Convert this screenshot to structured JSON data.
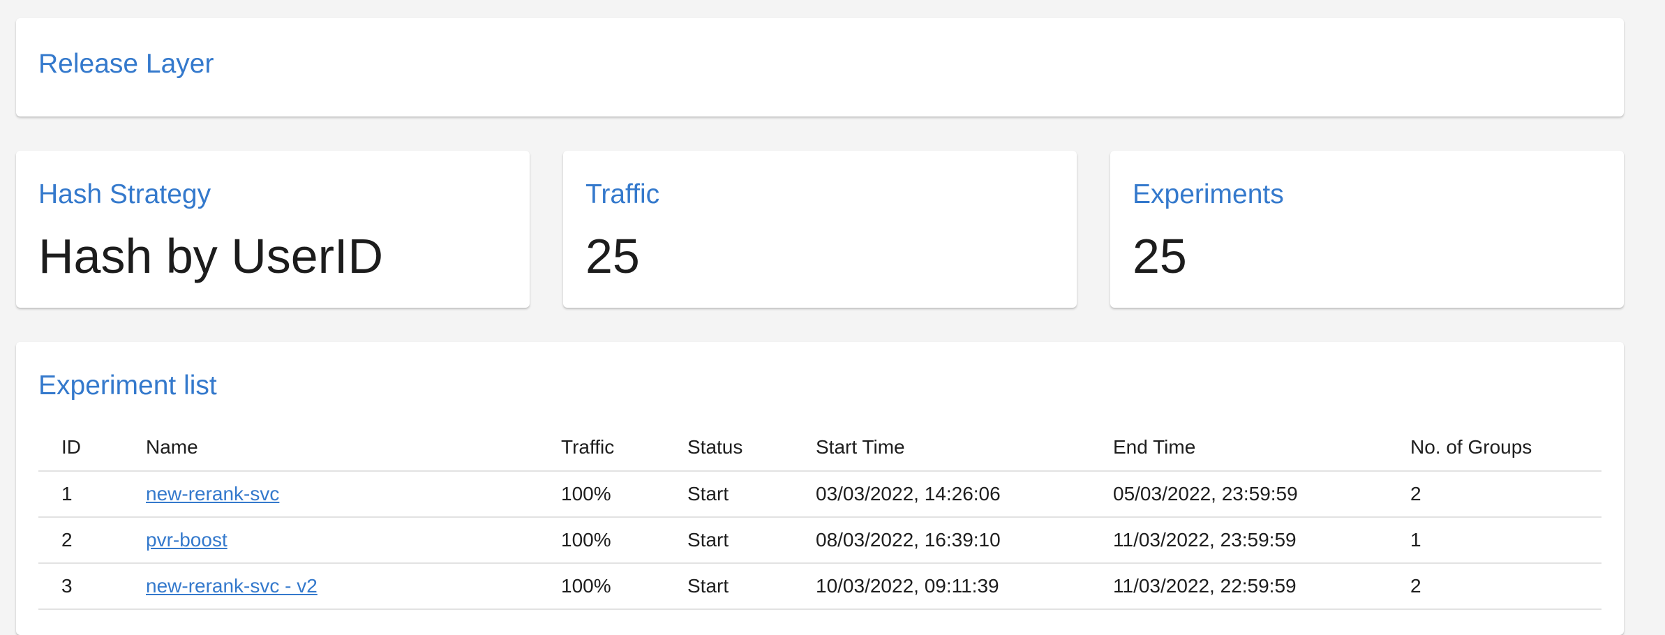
{
  "release_layer": {
    "title": "Release Layer"
  },
  "stats": [
    {
      "title": "Hash Strategy",
      "value": "Hash by UserID"
    },
    {
      "title": "Traffic",
      "value": "25"
    },
    {
      "title": "Experiments",
      "value": "25"
    }
  ],
  "experiment_list": {
    "title": "Experiment list",
    "columns": [
      "ID",
      "Name",
      "Traffic",
      "Status",
      "Start Time",
      "End Time",
      "No. of Groups"
    ],
    "rows": [
      {
        "id": "1",
        "name": "new-rerank-svc",
        "traffic": "100%",
        "status": "Start",
        "start": "03/03/2022, 14:26:06",
        "end": "05/03/2022, 23:59:59",
        "groups": "2"
      },
      {
        "id": "2",
        "name": "pvr-boost",
        "traffic": "100%",
        "status": "Start",
        "start": "08/03/2022, 16:39:10",
        "end": "11/03/2022, 23:59:59",
        "groups": "1"
      },
      {
        "id": "3",
        "name": "new-rerank-svc - v2",
        "traffic": "100%",
        "status": "Start",
        "start": "10/03/2022, 09:11:39",
        "end": "11/03/2022, 22:59:59",
        "groups": "2"
      }
    ]
  },
  "colors": {
    "accent": "#3479cc",
    "background": "#f4f4f4",
    "card": "#ffffff",
    "text": "#1c1c1c"
  }
}
